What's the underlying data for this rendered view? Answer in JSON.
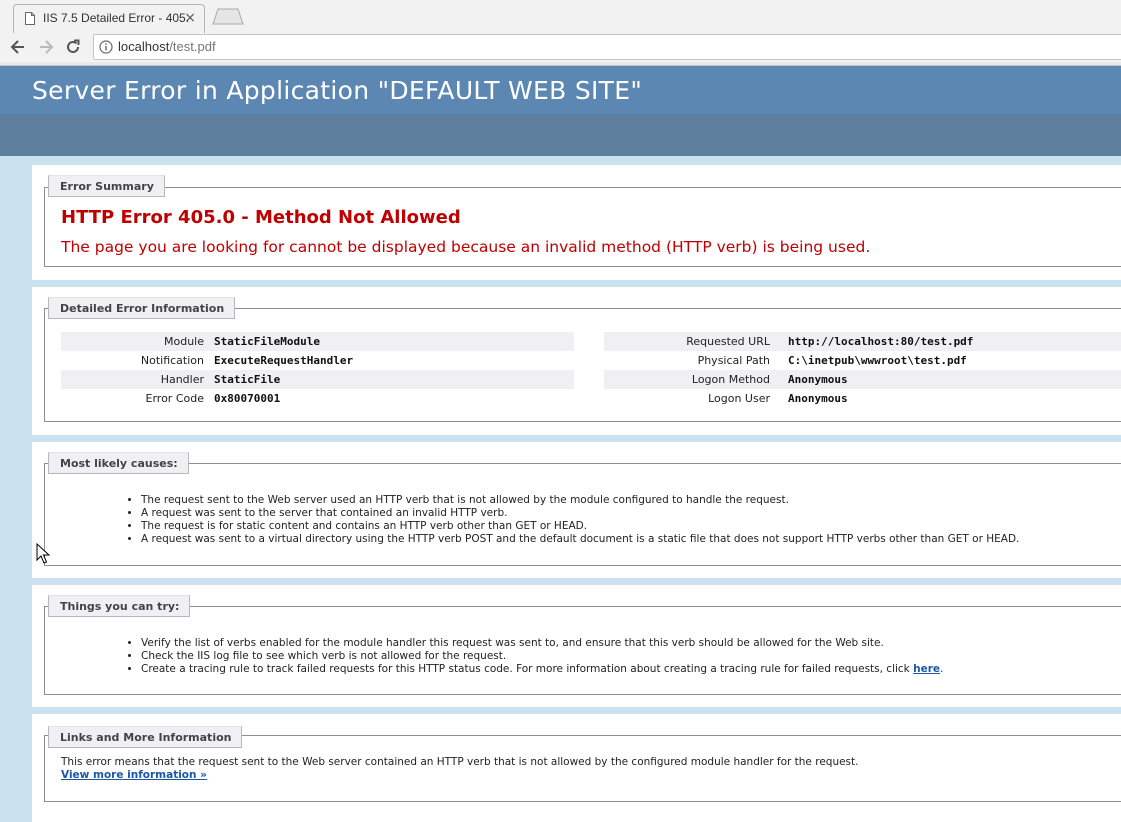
{
  "browser": {
    "tab_title": "IIS 7.5 Detailed Error - 405.",
    "tab_close": "×",
    "url_host": "localhost",
    "url_path": "/test.pdf"
  },
  "page": {
    "header_title": "Server Error in Application \"DEFAULT WEB SITE\"",
    "summary": {
      "legend": "Error Summary",
      "title": "HTTP Error 405.0 - Method Not Allowed",
      "subtitle": "The page you are looking for cannot be displayed because an invalid method (HTTP verb) is being used."
    },
    "details": {
      "legend": "Detailed Error Information",
      "left": [
        {
          "key": "Module",
          "value": "StaticFileModule"
        },
        {
          "key": "Notification",
          "value": "ExecuteRequestHandler"
        },
        {
          "key": "Handler",
          "value": "StaticFile"
        },
        {
          "key": "Error Code",
          "value": "0x80070001"
        }
      ],
      "right": [
        {
          "key": "Requested URL",
          "value": "http://localhost:80/test.pdf"
        },
        {
          "key": "Physical Path",
          "value": "C:\\inetpub\\wwwroot\\test.pdf"
        },
        {
          "key": "Logon Method",
          "value": "Anonymous"
        },
        {
          "key": "Logon User",
          "value": "Anonymous"
        }
      ]
    },
    "causes": {
      "legend": "Most likely causes:",
      "items": [
        "The request sent to the Web server used an HTTP verb that is not allowed by the module configured to handle the request.",
        "A request was sent to the server that contained an invalid HTTP verb.",
        "The request is for static content and contains an HTTP verb other than GET or HEAD.",
        "A request was sent to a virtual directory using the HTTP verb POST and the default document is a static file that does not support HTTP verbs other than GET or HEAD."
      ]
    },
    "try": {
      "legend": "Things you can try:",
      "items": [
        "Verify the list of verbs enabled for the module handler this request was sent to, and ensure that this verb should be allowed for the Web site.",
        "Check the IIS log file to see which verb is not allowed for the request."
      ],
      "last_item_prefix": "Create a tracing rule to track failed requests for this HTTP status code. For more information about creating a tracing rule for failed requests, click ",
      "last_item_link": "here",
      "last_item_suffix": "."
    },
    "links": {
      "legend": "Links and More Information",
      "text": "This error means that the request sent to the Web server contained an HTTP verb that is not allowed by the configured module handler for the request.",
      "more_link": "View more information »"
    }
  },
  "colors": {
    "header_bg": "#5c87b2",
    "subheader_bg": "#5f7f9f",
    "page_bg": "#cbe1ef",
    "error_red": "#c00000",
    "link_blue": "#1b57a6"
  }
}
